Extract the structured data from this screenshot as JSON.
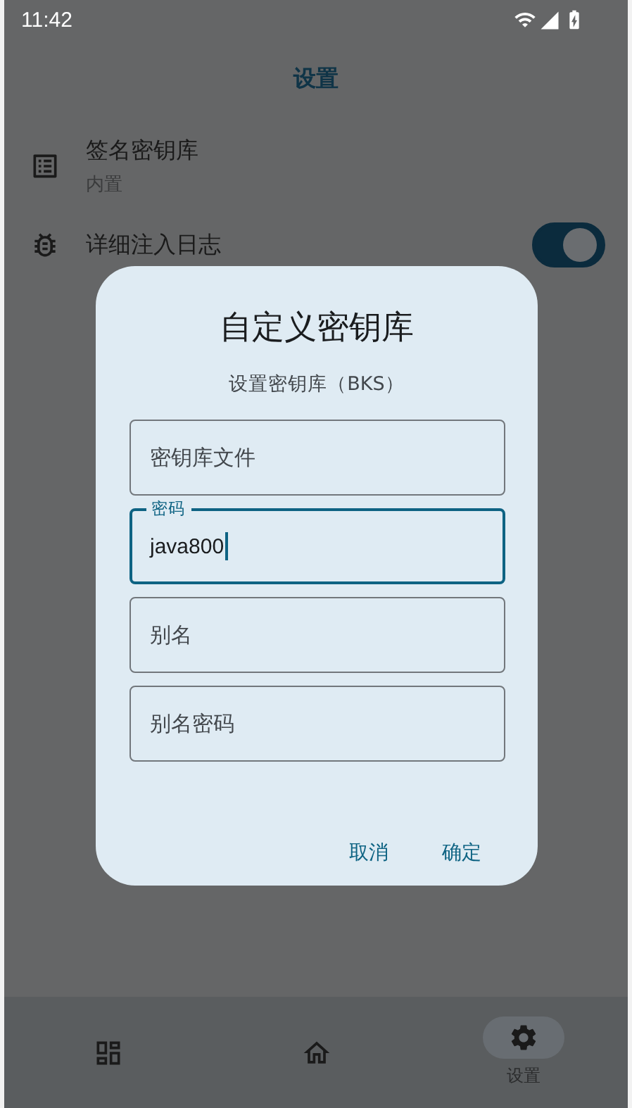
{
  "status_bar": {
    "time": "11:42"
  },
  "title": "设置",
  "settings": [
    {
      "kind": "item",
      "title": "签名密钥库",
      "subtitle": "内置"
    },
    {
      "kind": "switch",
      "title": "详细注入日志",
      "on": true
    }
  ],
  "dialog": {
    "title": "自定义密钥库",
    "subtitle": "设置密钥库（BKS）",
    "fields": [
      {
        "label": "密钥库文件",
        "focused": false
      },
      {
        "label": "密码",
        "value": "java800",
        "focused": true
      },
      {
        "label": "别名",
        "focused": false
      },
      {
        "label": "别名密码",
        "focused": false
      }
    ],
    "buttons": [
      "取消",
      "确定"
    ]
  },
  "bottom_nav": [
    {
      "kind": "dashboard",
      "selected": false
    },
    {
      "kind": "home",
      "selected": false
    },
    {
      "kind": "settings",
      "label": "设置",
      "selected": true
    }
  ]
}
